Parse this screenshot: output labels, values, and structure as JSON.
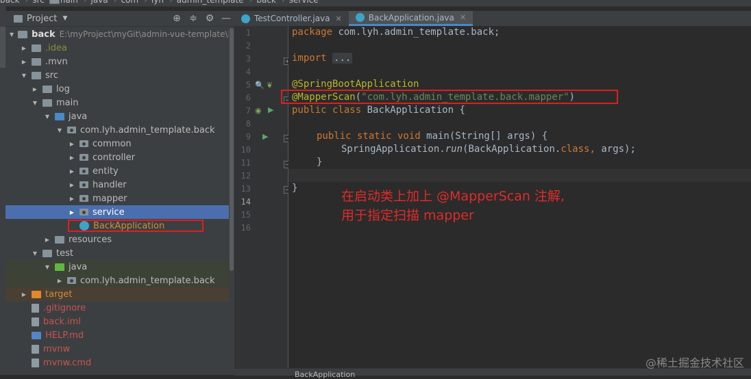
{
  "breadcrumb": [
    "back",
    "src",
    "main",
    "java",
    "com",
    "lyh",
    "admin_template",
    "back",
    "service"
  ],
  "project_panel": {
    "title": "Project",
    "tree": [
      {
        "label": "back",
        "path": "E:\\myProject\\myGit\\admin-vue-template\\back",
        "icon": "folder-icon"
      },
      {
        "label": ".idea",
        "icon": "folder-icon"
      },
      {
        "label": ".mvn",
        "icon": "folder-icon"
      },
      {
        "label": "src",
        "icon": "folder-icon"
      },
      {
        "label": "log",
        "icon": "folder-icon"
      },
      {
        "label": "main",
        "icon": "folder-icon"
      },
      {
        "label": "java",
        "icon": "source-folder-icon"
      },
      {
        "label": "com.lyh.admin_template.back",
        "icon": "package-icon"
      },
      {
        "label": "common",
        "icon": "package-icon"
      },
      {
        "label": "controller",
        "icon": "package-icon"
      },
      {
        "label": "entity",
        "icon": "package-icon"
      },
      {
        "label": "handler",
        "icon": "package-icon"
      },
      {
        "label": "mapper",
        "icon": "package-icon"
      },
      {
        "label": "service",
        "icon": "package-icon"
      },
      {
        "label": "BackApplication",
        "icon": "spring-class-icon"
      },
      {
        "label": "resources",
        "icon": "folder-icon"
      },
      {
        "label": "test",
        "icon": "folder-icon"
      },
      {
        "label": "java",
        "icon": "test-folder-icon"
      },
      {
        "label": "com.lyh.admin_template.back",
        "icon": "package-icon"
      },
      {
        "label": "target",
        "icon": "excluded-folder-icon"
      },
      {
        "label": ".gitignore",
        "icon": "file-icon"
      },
      {
        "label": "back.iml",
        "icon": "file-icon"
      },
      {
        "label": "HELP.md",
        "icon": "markdown-icon"
      },
      {
        "label": "mvnw",
        "icon": "file-icon"
      },
      {
        "label": "mvnw.cmd",
        "icon": "file-icon"
      }
    ]
  },
  "tabs": [
    {
      "label": "TestController.java",
      "active": false
    },
    {
      "label": "BackApplication.java",
      "active": true
    }
  ],
  "editor": {
    "line_numbers": [
      "1",
      "2",
      "3",
      "4",
      "5",
      "6",
      "7",
      "8",
      "9",
      "10",
      "11",
      "12",
      "13",
      "14",
      "15",
      "16"
    ],
    "current_line": "14",
    "code": {
      "l1_kw": "package",
      "l1_rest": " com.lyh.admin_template.back;",
      "l3_kw": "import",
      "l3_dots": "...",
      "l7_ann": "@SpringBootApplication",
      "l8_ann": "@MapperScan",
      "l8_open": "(",
      "l8_str": "\"com.lyh.admin_template.back.mapper\"",
      "l8_close": ")",
      "l9_kw": "public class",
      "l9_rest": " BackApplication {",
      "l11_kw": "public static void",
      "l11_rest": " main(String[] args) {",
      "l12_pre": "SpringApplication.",
      "l12_run": "run",
      "l12_mid": "(BackApplication.",
      "l12_kw": "class",
      "l12_sep": ",",
      "l12_end": " args);",
      "l13": "}",
      "l15": "}"
    }
  },
  "annotation": {
    "line1": "在启动类上加上 @MapperScan 注解,",
    "line2": "用于指定扫描 mapper"
  },
  "status_bottom": "BackApplication",
  "watermark": "@稀土掘金技术社区"
}
